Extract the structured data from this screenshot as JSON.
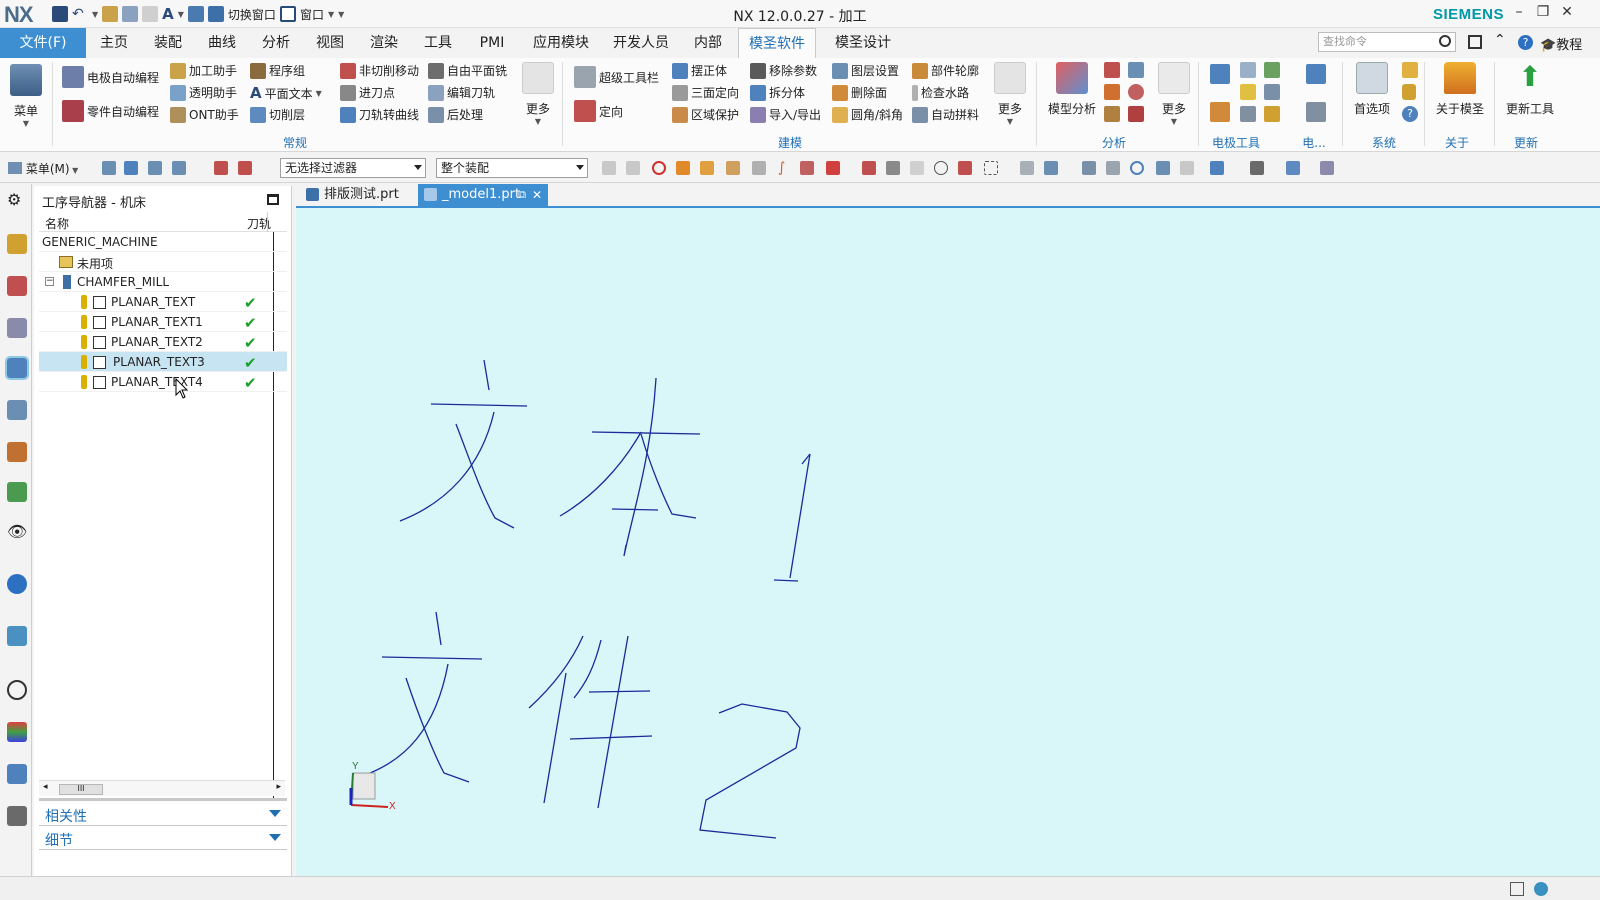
{
  "titlebar": {
    "app_logo": "NX",
    "switch_window": "切换窗口",
    "window_menu": "窗口",
    "title": "NX 12.0.0.27 - 加工",
    "brand": "SIEMENS"
  },
  "menubar": {
    "file": "文件(F)",
    "items": [
      "主页",
      "装配",
      "曲线",
      "分析",
      "视图",
      "渲染",
      "工具",
      "PMI",
      "应用模块",
      "开发人员",
      "内部",
      "模圣软件",
      "模圣设计"
    ],
    "active_index": 11,
    "search_placeholder": "查找命令",
    "tutorial": "教程"
  },
  "ribbon": {
    "menu_big": "菜单",
    "general": {
      "col1": [
        "电极自动编程",
        "零件自动编程"
      ],
      "col2": [
        "加工助手",
        "透明助手",
        "ONT助手"
      ],
      "col3": [
        "程序组",
        "平面文本",
        "切削层"
      ],
      "col4": [
        "非切削移动",
        "进刀点",
        "刀轨转曲线"
      ],
      "col5": [
        "自由平面铣",
        "编辑刀轨",
        "后处理"
      ],
      "more": "更多",
      "label": "常规"
    },
    "modeling": {
      "col1": [
        "超级工具栏",
        "定向"
      ],
      "col2": [
        "摆正体",
        "三面定向",
        "区域保护"
      ],
      "col3": [
        "移除参数",
        "拆分体",
        "导入/导出"
      ],
      "col4": [
        "图层设置",
        "删除面",
        "圆角/斜角"
      ],
      "col5": [
        "部件轮廓",
        "检查水路",
        "自动拼料"
      ],
      "more": "更多",
      "label": "建模"
    },
    "analysis": {
      "big": "模型分析",
      "more": "更多",
      "label": "分析"
    },
    "electrode": {
      "label": "电极工具",
      "label2": "电..."
    },
    "system": {
      "big": "首选项",
      "label": "系统"
    },
    "about": {
      "big": "关于模圣",
      "label": "关于"
    },
    "update": {
      "big": "更新工具",
      "label": "更新"
    }
  },
  "toolbar2": {
    "menu": "菜单(M)",
    "filter": "无选择过滤器",
    "assembly": "整个装配"
  },
  "navigator": {
    "title": "工序导航器 - 机床",
    "col_name": "名称",
    "col_path": "刀轨",
    "rows": [
      {
        "label": "GENERIC_MACHINE",
        "level": 0,
        "type": "root",
        "check": ""
      },
      {
        "label": "未用项",
        "level": 1,
        "type": "folder",
        "check": ""
      },
      {
        "label": "CHAMFER_MILL",
        "level": 1,
        "type": "tool",
        "check": ""
      },
      {
        "label": "PLANAR_TEXT",
        "level": 2,
        "type": "op",
        "check": "✔"
      },
      {
        "label": "PLANAR_TEXT1",
        "level": 2,
        "type": "op",
        "check": "✔"
      },
      {
        "label": "PLANAR_TEXT2",
        "level": 2,
        "type": "op",
        "check": "✔"
      },
      {
        "label": "PLANAR_TEXT3",
        "level": 2,
        "type": "op",
        "check": "✔",
        "selected": true
      },
      {
        "label": "PLANAR_TEXT4",
        "level": 2,
        "type": "op",
        "check": "✔"
      }
    ],
    "dependencies": "相关性",
    "details": "细节"
  },
  "tabs": [
    {
      "label": "排版测试.prt",
      "active": false
    },
    {
      "label": "_model1.prt",
      "active": true
    }
  ],
  "viewport": {
    "triad_x": "X",
    "triad_y": "Y",
    "stroke_color": "#1a2a9a",
    "background": "#d9f6f8"
  }
}
